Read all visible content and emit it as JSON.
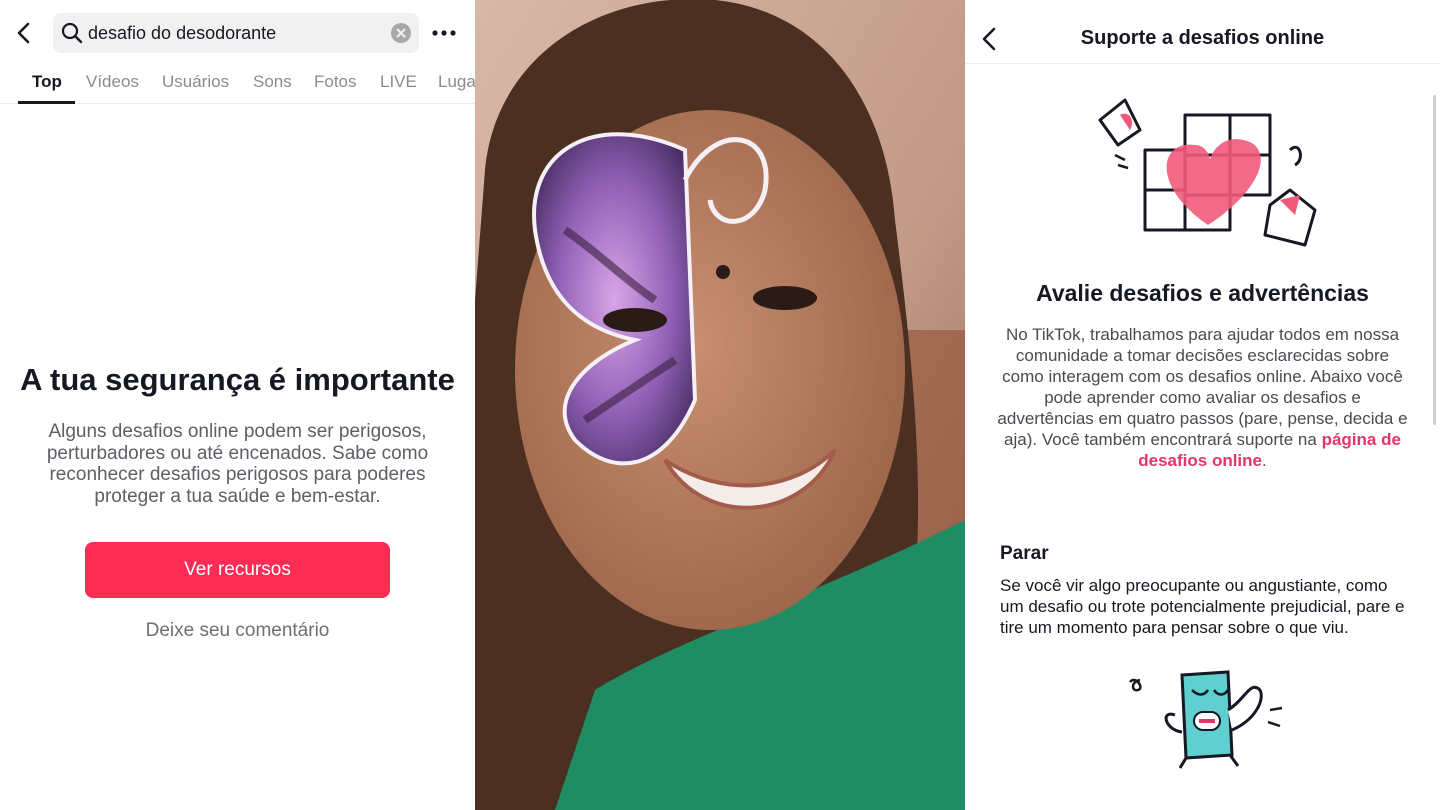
{
  "left_panel": {
    "search": {
      "value": "desafio do desodorante"
    },
    "tabs": [
      "Top",
      "Vídeos",
      "Usuários",
      "Sons",
      "Fotos",
      "LIVE",
      "Luga"
    ],
    "safety_title": "A tua segurança é importante",
    "safety_desc": "Alguns desafios online podem ser perigosos, perturbadores ou até encenados. Sabe como reconhecer desafios perigosos para poderes proteger a tua saúde e bem-estar.",
    "primary_button": "Ver recursos",
    "secondary_link": "Deixe seu comentário",
    "accent_color": "#fe2c55"
  },
  "right_panel": {
    "title": "Suporte a desafios online",
    "heading": "Avalie desafios e advertências",
    "intro": "No TikTok, trabalhamos para ajudar todos em nossa comunidade a tomar decisões esclarecidas sobre como interagem com os desafios online. Abaixo você pode aprender como avaliar os desafios e advertências em quatro passos (pare, pense, decida e aja). Você também encontrará suporte na",
    "intro_link": "página de desafios online",
    "intro_end": ".",
    "section_title": "Parar",
    "section_text": "Se você vir algo preocupante ou angustiante, como um desafio ou trote potencialmente prejudicial, pare e tire um momento para pensar sobre o que viu.",
    "link_color": "#e3366a"
  }
}
